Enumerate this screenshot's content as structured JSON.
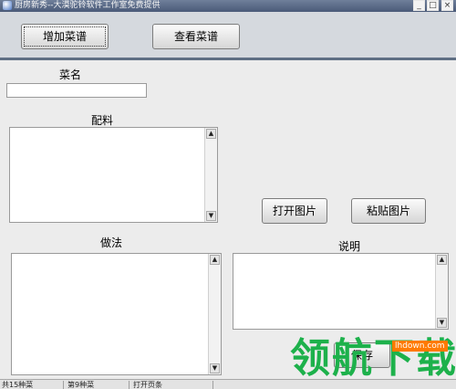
{
  "window": {
    "title": "厨房新秀--大漠驼铃软件工作室免费提供",
    "minimize_glyph": "_",
    "maximize_glyph": "□",
    "close_glyph": "×"
  },
  "toolbar": {
    "add_recipe_label": "增加菜谱",
    "view_recipe_label": "查看菜谱"
  },
  "form": {
    "dish_name_label": "菜名",
    "dish_name_value": "",
    "ingredients_label": "配料",
    "ingredients_value": "",
    "method_label": "做法",
    "method_value": "",
    "description_label": "说明",
    "description_value": "",
    "open_image_label": "打开图片",
    "paste_image_label": "粘贴图片",
    "save_label": "保存"
  },
  "scroll_icons": {
    "up": "▲",
    "down": "▼"
  },
  "statusbar": {
    "total": "共15种菜",
    "current": "第9种菜",
    "status": "打开页条"
  },
  "watermark": {
    "text": "领航下载",
    "url": "lhdown.com"
  },
  "colors": {
    "titlebar": "#4a5a78",
    "toolbar_bg": "#d5d9de",
    "toolbar_border": "#5f6f84",
    "watermark_green": "#1db14b",
    "watermark_orange": "#ff7a00"
  }
}
